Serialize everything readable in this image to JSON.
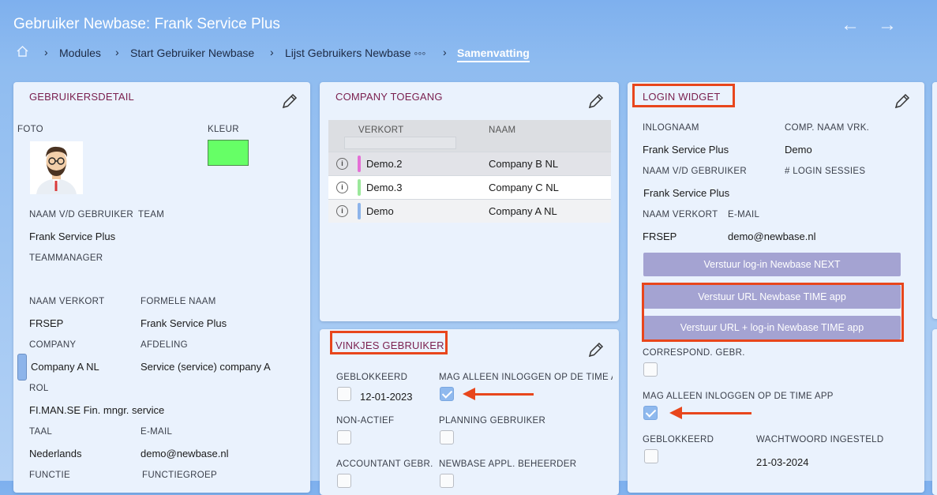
{
  "header": {
    "title": "Gebruiker Newbase: Frank Service Plus",
    "back_arrow": "←",
    "forward_arrow": "→"
  },
  "breadcrumb": {
    "home_icon": "home-icon",
    "separator": "›",
    "items": [
      "Modules",
      "Start Gebruiker Newbase",
      "Lijst Gebruikers Newbase ◦◦◦",
      "Samenvatting"
    ]
  },
  "gebruikersdetail": {
    "title": "GEBRUIKERSDETAIL",
    "foto_label": "FOTO",
    "kleur_label": "KLEUR",
    "kleur_color": "#66ff66",
    "naam_label": "NAAM V/D GEBRUIKER",
    "naam_value": "Frank Service Plus",
    "team_label": "TEAM",
    "team_value": "",
    "teammanager_label": "TEAMMANAGER",
    "teammanager_value": "",
    "verkort_label": "NAAM VERKORT",
    "verkort_value": "FRSEP",
    "formele_label": "FORMELE NAAM",
    "formele_value": "Frank Service Plus",
    "company_label": "COMPANY",
    "company_value": "Company A NL",
    "company_color": "#8db4ea",
    "afdeling_label": "AFDELING",
    "afdeling_value": "Service (service) company A",
    "rol_label": "ROL",
    "rol_value": "FI.MAN.SE Fin. mngr. service",
    "taal_label": "TAAL",
    "taal_value": "Nederlands",
    "email_label": "E-MAIL",
    "email_value": "demo@newbase.nl",
    "functie_label": "FUNCTIE",
    "functiegroep_label": "FUNCTIEGROEP"
  },
  "company_toegang": {
    "title": "COMPANY TOEGANG",
    "col_verkort": "VERKORT",
    "col_naam": "NAAM",
    "rows": [
      {
        "info_icon": "info-icon",
        "verkort": "Demo.2",
        "naam": "Company B NL",
        "color": "#e46fd6"
      },
      {
        "info_icon": "info-icon",
        "verkort": "Demo.3",
        "naam": "Company C NL",
        "color": "#9be89b"
      },
      {
        "info_icon": "info-icon",
        "verkort": "Demo",
        "naam": "Company A NL",
        "color": "#8db4ea"
      }
    ]
  },
  "vinkjes": {
    "title": "VINKJES GEBRUIKER",
    "geblokkeerd_label": "GEBLOKKEERD",
    "geblokkeerd_date": "12-01-2023",
    "geblokkeerd_checked": false,
    "mag_alleen_label": "MAG ALLEEN INLOGGEN OP DE TIME AF",
    "mag_alleen_checked": true,
    "nonactief_label": "NON-ACTIEF",
    "nonactief_checked": false,
    "planning_label": "PLANNING GEBRUIKER",
    "planning_checked": false,
    "accountant_label": "ACCOUNTANT GEBR.",
    "beheerder_label": "NEWBASE APPL. BEHEERDER"
  },
  "login_widget": {
    "title": "LOGIN WIDGET",
    "inlognaam_label": "INLOGNAAM",
    "inlognaam_value": "Frank Service Plus",
    "compnaam_label": "COMP. NAAM VRK.",
    "compnaam_value": "Demo",
    "naam_label": "NAAM V/D GEBRUIKER",
    "naam_value": "Frank Service Plus",
    "sessies_label": "# LOGIN SESSIES",
    "verkort_label": "NAAM VERKORT",
    "verkort_value": "FRSEP",
    "email_label": "E-MAIL",
    "email_value": "demo@newbase.nl",
    "btn_next": "Verstuur log-in Newbase NEXT",
    "btn_url": "Verstuur URL Newbase TIME app",
    "btn_url_login": "Verstuur URL + log-in Newbase TIME app",
    "correspond_label": "CORRESPOND. GEBR.",
    "correspond_checked": false,
    "mag_alleen_label": "MAG ALLEEN INLOGGEN OP DE TIME APP",
    "mag_alleen_checked": true,
    "geblokkeerd_label": "GEBLOKKEERD",
    "geblokkeerd_checked": false,
    "wachtwoord_label": "WACHTWOORD INGESTELD",
    "wachtwoord_value": "21-03-2024"
  }
}
